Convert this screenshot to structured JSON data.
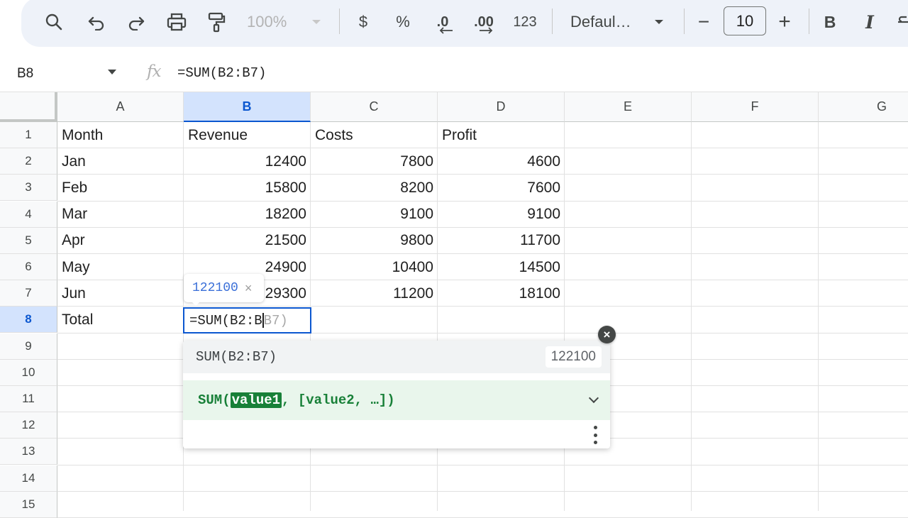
{
  "toolbar": {
    "zoom": "100%",
    "format_currency": "$",
    "format_percent": "%",
    "decrease_decimal": ".0",
    "increase_decimal": ".00",
    "more_formats": "123",
    "font_name": "Defaul…",
    "font_size": "10",
    "bold": "B",
    "italic": "I",
    "minus": "−",
    "plus": "+"
  },
  "formula_bar": {
    "cell_ref": "B8",
    "fx": "fx",
    "formula": "=SUM(B2:B7)"
  },
  "columns": [
    "A",
    "B",
    "C",
    "D",
    "E",
    "F",
    "G"
  ],
  "rows": [
    "1",
    "2",
    "3",
    "4",
    "5",
    "6",
    "7",
    "8",
    "9",
    "10",
    "11",
    "12",
    "13",
    "14",
    "15"
  ],
  "sheet": {
    "header": [
      "Month",
      "Revenue",
      "Costs",
      "Profit"
    ],
    "data": [
      [
        "Jan",
        "12400",
        "7800",
        "4600"
      ],
      [
        "Feb",
        "15800",
        "8200",
        "7600"
      ],
      [
        "Mar",
        "18200",
        "9100",
        "9100"
      ],
      [
        "Apr",
        "21500",
        "9800",
        "11700"
      ],
      [
        "May",
        "24900",
        "10400",
        "14500"
      ],
      [
        "Jun",
        "29300",
        "11200",
        "18100"
      ]
    ],
    "total_label": "Total"
  },
  "editor": {
    "typed": "=SUM(B2:B",
    "ghost": "B7)"
  },
  "preview": {
    "value": "122100",
    "close": "×"
  },
  "autocomplete": {
    "suggestion": "SUM(B2:B7)",
    "suggestion_value": "122100",
    "help_prefix": "SUM(",
    "help_param": "value1",
    "help_suffix": ", [value2, …])",
    "close": "×"
  }
}
